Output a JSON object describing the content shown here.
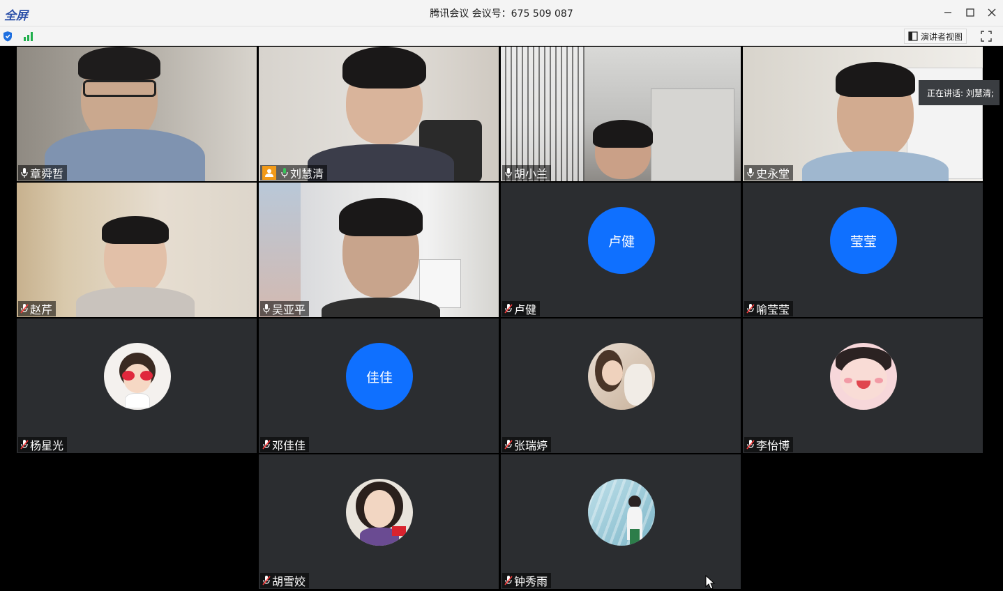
{
  "window": {
    "badge": "全屏",
    "title": "腾讯会议 会议号：675 509 087"
  },
  "toolbar": {
    "speaker_view_label": "演讲者视图",
    "security_icon": "shield-icon",
    "signal_icon": "signal-bars-icon"
  },
  "speaking_indicator": "正在讲话: 刘慧清;",
  "colors": {
    "avatar_blue": "#0f70ff",
    "tile_bg": "#2b2d30",
    "host_orange": "#f29a18",
    "speaking_green": "#2f8b4f"
  },
  "participants": [
    {
      "name": "章舜哲",
      "mic": "on",
      "type": "video"
    },
    {
      "name": "刘慧清",
      "mic": "speaking",
      "type": "video",
      "host": true
    },
    {
      "name": "胡小兰",
      "mic": "on",
      "type": "video"
    },
    {
      "name": "史永堂",
      "mic": "on",
      "type": "video"
    },
    {
      "name": "赵芹",
      "mic": "muted",
      "type": "video"
    },
    {
      "name": "吴亚平",
      "mic": "on",
      "type": "video"
    },
    {
      "name": "卢健",
      "mic": "muted",
      "type": "avatar",
      "avatar_text": "卢健"
    },
    {
      "name": "喻莹莹",
      "mic": "muted",
      "type": "avatar",
      "avatar_text": "莹莹"
    },
    {
      "name": "杨星光",
      "mic": "muted",
      "type": "photo-avatar"
    },
    {
      "name": "邓佳佳",
      "mic": "muted",
      "type": "avatar",
      "avatar_text": "佳佳"
    },
    {
      "name": "张瑞婷",
      "mic": "muted",
      "type": "photo-avatar"
    },
    {
      "name": "李怡博",
      "mic": "muted",
      "type": "photo-avatar"
    },
    {
      "name": "胡雪姣",
      "mic": "muted",
      "type": "photo-avatar"
    },
    {
      "name": "钟秀雨",
      "mic": "muted",
      "type": "photo-avatar"
    }
  ]
}
